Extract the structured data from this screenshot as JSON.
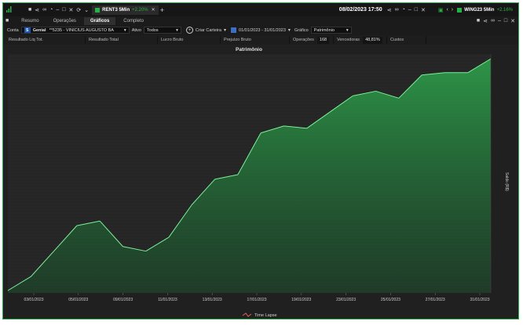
{
  "topbar": {
    "left_tab": {
      "symbol": "RENT3 5Min",
      "change": "+2.20%"
    },
    "datetime": "08/02/2023 17:50",
    "right_tab": {
      "symbol": "WING23 5Min",
      "change": "+2.16%"
    }
  },
  "tabs": [
    {
      "label": "Resumo"
    },
    {
      "label": "Operações"
    },
    {
      "label": "Gráficos"
    },
    {
      "label": "Completo"
    }
  ],
  "active_tab": "Gráficos",
  "conta": {
    "label": "Conta",
    "broker": "Genial",
    "account": "**5235 - VINICIUS AUGUSTO BA",
    "ativo_label": "Ativo",
    "ativo_value": "Todos",
    "criar_carteira": "Criar Carteira",
    "date_range": "01/01/2023 - 31/01/2023",
    "grafico_label": "Gráfico",
    "grafico_value": "Patrimônio"
  },
  "summary": {
    "resultado_liq": "Resultado Liq Tot.",
    "resultado_total": "Resultado Total",
    "lucro_bruto": "Lucro Bruto",
    "prejuizo_bruto": "Prejuízo Bruto",
    "operacoes_label": "Operações",
    "operacoes_value": "168",
    "vencedoras_label": "Vencedoras",
    "vencedoras_value": "48,81%",
    "custos_label": "Custos"
  },
  "chart_data": {
    "type": "area",
    "title": "Patrimônio",
    "ylabel": "Saldo (R$)",
    "legend": [
      "Time Lapse"
    ],
    "legend_position": "bottom-center",
    "color": "#2ea84d",
    "x_tick_labels": [
      "03/01/2023",
      "05/01/2023",
      "09/01/2023",
      "11/01/2023",
      "13/01/2023",
      "17/01/2023",
      "19/01/2023",
      "23/01/2023",
      "25/01/2023",
      "27/01/2023",
      "31/01/2023"
    ],
    "ylim": [
      0,
      100
    ],
    "y_tick_labels_visible": false,
    "series": [
      {
        "name": "Time Lapse",
        "values": [
          0,
          6,
          17,
          28,
          30,
          19,
          17,
          23,
          37,
          48,
          50,
          68,
          71,
          70,
          77,
          84,
          86,
          83,
          93,
          94,
          94,
          100
        ]
      }
    ]
  }
}
